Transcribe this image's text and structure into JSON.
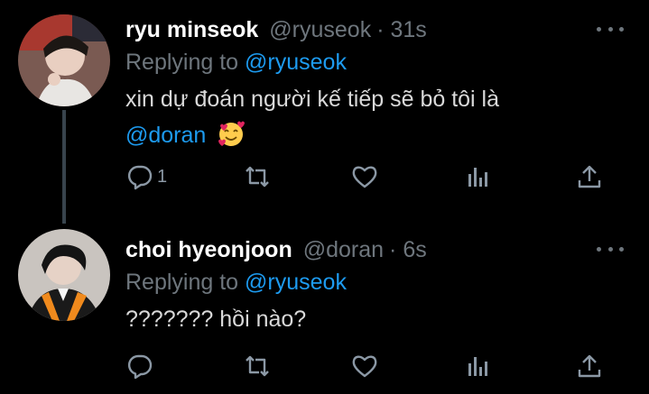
{
  "tweets": [
    {
      "name": "ryu minseok",
      "handle": "@ryuseok",
      "time": "· 31s",
      "replying_prefix": "Replying to",
      "replying_to": "@ryuseok",
      "text_line1": "xin dự đoán người kế tiếp sẽ bỏ tôi là",
      "mention": "@doran",
      "emoji": "smiling-face-with-hearts",
      "reply_count": "1"
    },
    {
      "name": "choi hyeonjoon",
      "handle": "@doran",
      "time": "· 6s",
      "replying_prefix": "Replying to",
      "replying_to": "@ryuseok",
      "text": "??????? hồi nào?",
      "reply_count": ""
    }
  ],
  "colors": {
    "background": "#000000",
    "text": "#d9d9d9",
    "name": "#ffffff",
    "muted": "#6e767d",
    "link": "#1d9bf0",
    "thread_line": "#38444d"
  },
  "icons": [
    "reply-icon",
    "retweet-icon",
    "like-icon",
    "analytics-icon",
    "share-icon",
    "more-icon"
  ]
}
